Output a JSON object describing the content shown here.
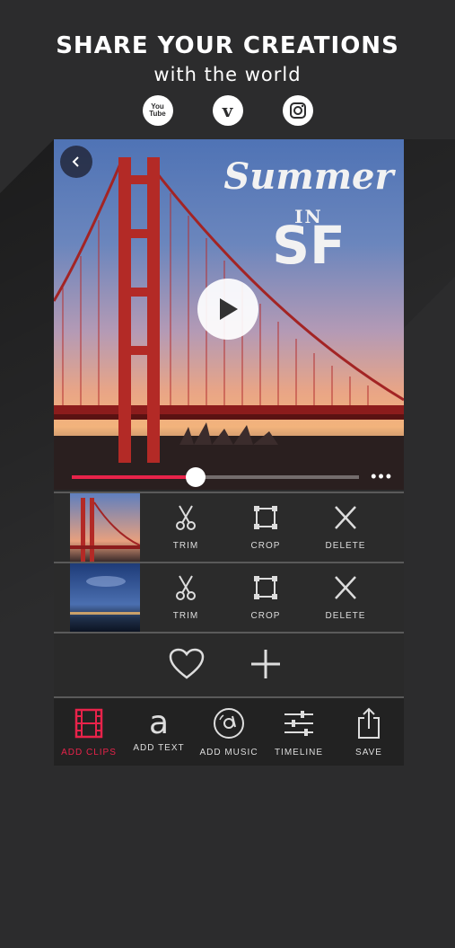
{
  "promo": {
    "headline": "SHARE YOUR CREATIONS",
    "subline": "with the world",
    "social": [
      {
        "icon": "youtube-icon",
        "label": "You Tube"
      },
      {
        "icon": "vine-icon",
        "label": "v"
      },
      {
        "icon": "instagram-icon",
        "label": ""
      }
    ]
  },
  "video": {
    "title_line1": "Summer",
    "title_line2": "IN",
    "title_line3": "SF",
    "progress": 0.43,
    "more_label": "•••"
  },
  "clips": [
    {
      "tools": [
        {
          "label": "TRIM",
          "icon": "scissors-icon"
        },
        {
          "label": "CROP",
          "icon": "crop-icon"
        },
        {
          "label": "DELETE",
          "icon": "close-icon"
        }
      ]
    },
    {
      "tools": [
        {
          "label": "TRIM",
          "icon": "scissors-icon"
        },
        {
          "label": "CROP",
          "icon": "crop-icon"
        },
        {
          "label": "DELETE",
          "icon": "close-icon"
        }
      ]
    }
  ],
  "tabbar": [
    {
      "label": "ADD CLIPS",
      "icon": "film-icon",
      "active": true
    },
    {
      "label": "ADD TEXT",
      "icon": "text-icon",
      "glyph": "a"
    },
    {
      "label": "ADD MUSIC",
      "icon": "music-disc-icon"
    },
    {
      "label": "TIMELINE",
      "icon": "sliders-icon"
    },
    {
      "label": "SAVE",
      "icon": "share-icon"
    }
  ],
  "colors": {
    "accent": "#e8234a",
    "background": "#2c2c2d"
  }
}
